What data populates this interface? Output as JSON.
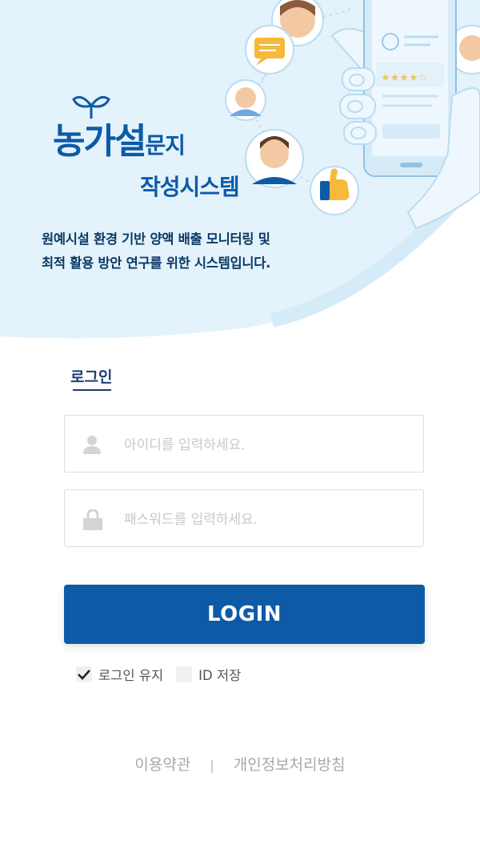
{
  "brand": {
    "title_large": "농가설",
    "title_small": "문지",
    "title_line2": "작성시스템"
  },
  "description": {
    "line1": "원예시설 환경 기반 양액 배출 모니터링 및",
    "line2": "최적 활용 방안 연구를 위한 시스템입니다."
  },
  "login": {
    "tab_label": "로그인",
    "id_placeholder": "아이디를 입력하세요.",
    "pw_placeholder": "패스워드를 입력하세요.",
    "button_label": "LOGIN",
    "keep_login_label": "로그인 유지",
    "keep_login_checked": true,
    "save_id_label": "ID 저장",
    "save_id_checked": false
  },
  "footer": {
    "terms": "이용약관",
    "separator": "|",
    "privacy": "개인정보처리방침"
  },
  "colors": {
    "primary": "#0d5ba6",
    "hero_bg": "#e3f2fb"
  },
  "icons": [
    "sprout-logo-icon",
    "user-icon",
    "lock-icon",
    "checkmark-icon"
  ]
}
